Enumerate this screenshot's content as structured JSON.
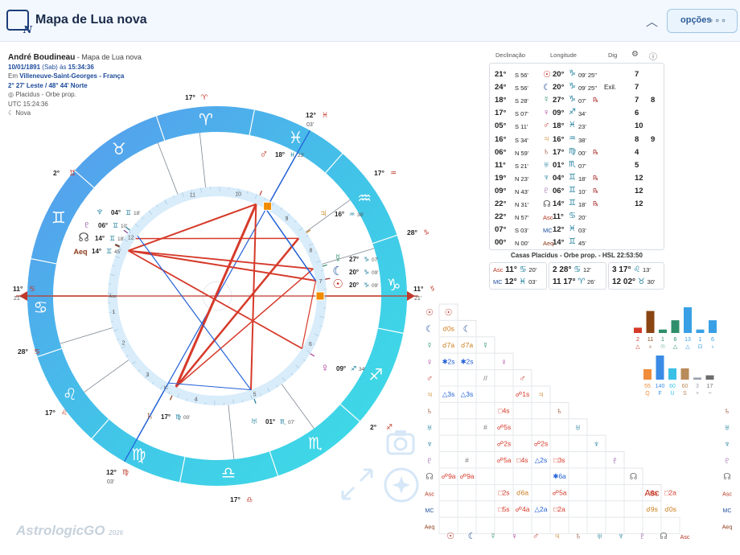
{
  "app": {
    "title": "Mapa de Lua nova",
    "options_label": "opções",
    "options_dots": "∘∘∘",
    "icon_letter": "N"
  },
  "info": {
    "name": "André Boudineau",
    "chart_kind": " - Mapa de Lua nova",
    "date": "10/01/1891",
    "weekday": "(Sab) às",
    "time": "15:34:36",
    "place_prefix": "Em",
    "place": "Villeneuve-Saint-Georges - França",
    "coords": "2° 27' Leste / 48° 44' Norte",
    "system": "Placidus - Orbe prop.",
    "utc": "UTC 15:24:36",
    "phase": "Nova"
  },
  "table": {
    "headers": {
      "decl": "Declinação",
      "long": "Longitude",
      "dig": "Dig"
    },
    "rows": [
      {
        "d": "21°",
        "dm": "S 56'",
        "g": "☉",
        "gc": "#c0392b",
        "lv": "20°",
        "s": "♑",
        "lm": "09' 25''",
        "rt": "",
        "dg": "",
        "n1": "7",
        "n2": ""
      },
      {
        "d": "24°",
        "dm": "S 56'",
        "g": "☾",
        "gc": "#1d4fa0",
        "lv": "20°",
        "s": "♑",
        "lm": "09' 25''",
        "rt": "",
        "dg": "Exil.",
        "n1": "7",
        "n2": ""
      },
      {
        "d": "18°",
        "dm": "S 28'",
        "g": "☿",
        "gc": "#2f8f6a",
        "lv": "27°",
        "s": "♑",
        "lm": "07'",
        "rt": "℞",
        "dg": "",
        "n1": "7",
        "n2": "8"
      },
      {
        "d": "17°",
        "dm": "S 07'",
        "g": "♀",
        "gc": "#a7359a",
        "lv": "09°",
        "s": "♐",
        "lm": "34'",
        "rt": "",
        "dg": "",
        "n1": "6",
        "n2": ""
      },
      {
        "d": "05°",
        "dm": "S 11'",
        "g": "♂",
        "gc": "#c0392b",
        "lv": "18°",
        "s": "♓",
        "lm": "23'",
        "rt": "",
        "dg": "",
        "n1": "10",
        "n2": ""
      },
      {
        "d": "16°",
        "dm": "S 34'",
        "g": "♃",
        "gc": "#c97a16",
        "lv": "16°",
        "s": "♒",
        "lm": "38'",
        "rt": "",
        "dg": "",
        "n1": "8",
        "n2": "9"
      },
      {
        "d": "06°",
        "dm": "N 59'",
        "g": "♄",
        "gc": "#8b3a1a",
        "lv": "17°",
        "s": "♍",
        "lm": "00'",
        "rt": "℞",
        "dg": "",
        "n1": "4",
        "n2": ""
      },
      {
        "d": "11°",
        "dm": "S 21'",
        "g": "♅",
        "gc": "#1b7d9a",
        "lv": "01°",
        "s": "♏",
        "lm": "07'",
        "rt": "",
        "dg": "",
        "n1": "5",
        "n2": ""
      },
      {
        "d": "19°",
        "dm": "N 23'",
        "g": "♆",
        "gc": "#1b7d9a",
        "lv": "04°",
        "s": "♊",
        "lm": "18'",
        "rt": "℞",
        "dg": "",
        "n1": "12",
        "n2": ""
      },
      {
        "d": "09°",
        "dm": "N 43'",
        "g": "♇",
        "gc": "#7b3590",
        "lv": "06°",
        "s": "♊",
        "lm": "10'",
        "rt": "℞",
        "dg": "",
        "n1": "12",
        "n2": ""
      },
      {
        "d": "22°",
        "dm": "N 31'",
        "g": "☊",
        "gc": "#555",
        "lv": "14°",
        "s": "♊",
        "lm": "18'",
        "rt": "℞",
        "dg": "",
        "n1": "12",
        "n2": ""
      },
      {
        "d": "22°",
        "dm": "N 57'",
        "g": "Asc",
        "gc": "#b8331f",
        "lv": "11°",
        "s": "♋",
        "lm": "20'",
        "rt": "",
        "dg": "",
        "n1": "",
        "n2": ""
      },
      {
        "d": "07°",
        "dm": "S 03'",
        "g": "MC",
        "gc": "#1d4fa0",
        "lv": "12°",
        "s": "♓",
        "lm": "03'",
        "rt": "",
        "dg": "",
        "n1": "",
        "n2": ""
      },
      {
        "d": "00°",
        "dm": "N 00'",
        "g": "Aeq",
        "gc": "#8b3a1a",
        "lv": "14°",
        "s": "♊",
        "lm": "45'",
        "rt": "",
        "dg": "",
        "n1": "",
        "n2": ""
      }
    ]
  },
  "houses": {
    "title": "Casas Placidus - Orbe prop. - HSL 22:53:50",
    "a": [
      {
        "h": "Asc",
        "v": "11°",
        "s": "♋",
        "m": "20'"
      },
      {
        "h": "MC",
        "v": "12°",
        "s": "♓",
        "m": "03'"
      }
    ],
    "b": [
      {
        "h": "2",
        "v": "28°",
        "s": "♋",
        "m": "12'"
      },
      {
        "h": "11",
        "v": "17°",
        "s": "♈",
        "m": "26'"
      }
    ],
    "c": [
      {
        "h": "3",
        "v": "17°",
        "s": "♌",
        "m": "13'"
      },
      {
        "h": "12",
        "v": "02°",
        "s": "♉",
        "m": "30'"
      }
    ]
  },
  "wheel": {
    "cusp_labels": [
      {
        "t": "11°",
        "s": "♋",
        "m": "21'",
        "side": "left"
      },
      {
        "t": "11°",
        "s": "♑",
        "m": "21'",
        "side": "right"
      },
      {
        "t": "12°",
        "s": "♓",
        "m": "03'"
      },
      {
        "t": "12°",
        "s": "♍",
        "m": "03'"
      },
      {
        "t": "17°",
        "s": "♈"
      },
      {
        "t": "17°",
        "s": "♎"
      },
      {
        "t": "17°",
        "s": "♒"
      },
      {
        "t": "17°",
        "s": "♌"
      },
      {
        "t": "28°",
        "s": "♑"
      },
      {
        "t": "28°",
        "s": "♋"
      },
      {
        "t": "2°",
        "s": "♊"
      },
      {
        "t": "2°",
        "s": "♐"
      }
    ],
    "planet_labels": [
      {
        "g": "♂",
        "t": "18°",
        "s": "♓",
        "m": "23'"
      },
      {
        "g": "♃",
        "t": "16°",
        "s": "♒",
        "m": "38'"
      },
      {
        "g": "☿",
        "t": "27°",
        "s": "♑",
        "m": "07'"
      },
      {
        "g": "☾",
        "t": "20°",
        "s": "♑",
        "m": "09'"
      },
      {
        "g": "☉",
        "t": "20°",
        "s": "♑",
        "m": "09'"
      },
      {
        "g": "♀",
        "t": "09°",
        "s": "♐",
        "m": "34'"
      },
      {
        "g": "♅",
        "t": "01°",
        "s": "♏",
        "m": "07'"
      },
      {
        "g": "♄",
        "t": "17°",
        "s": "♍",
        "m": "00'"
      },
      {
        "g": "♆",
        "t": "04°",
        "s": "♊",
        "m": "18'"
      },
      {
        "g": "♇",
        "t": "06°",
        "s": "♊",
        "m": "10'"
      },
      {
        "g": "☊",
        "t": "14°",
        "s": "♊",
        "m": "18'"
      },
      {
        "g": "Aeq",
        "t": "14°",
        "s": "♊",
        "m": "45'"
      }
    ],
    "zodiac_symbols": [
      "♈",
      "♉",
      "♊",
      "♋",
      "♌",
      "♍",
      "♎",
      "♏",
      "♐",
      "♑",
      "♒",
      "♓"
    ],
    "house_numbers": [
      "1",
      "2",
      "3",
      "4",
      "5",
      "6",
      "7",
      "8",
      "9",
      "10",
      "11",
      "12"
    ],
    "axis_labels": [
      "Asc",
      "Dsc",
      "MC",
      "IC"
    ]
  },
  "stats": {
    "top": [
      {
        "v": "2",
        "k": "△"
      },
      {
        "v": "11",
        "k": "♁"
      },
      {
        "v": "1",
        "k": "☉"
      },
      {
        "v": "6",
        "k": "△"
      },
      {
        "v": "13",
        "k": "△"
      },
      {
        "v": "1",
        "k": "⊡"
      },
      {
        "v": "6",
        "k": "♁"
      }
    ],
    "bottom": [
      {
        "v": "55",
        "k": "Q"
      },
      {
        "v": "140",
        "k": "F"
      },
      {
        "v": "60",
        "k": "Ú"
      },
      {
        "v": "60",
        "k": "S"
      },
      {
        "v": "3",
        "k": "+"
      },
      {
        "v": "17",
        "k": "−"
      }
    ]
  },
  "aspect_grid": {
    "rows": [
      "☉",
      "☾",
      "☿",
      "♀",
      "♂",
      "♃",
      "♄",
      "♅",
      "♆",
      "♇",
      "☊",
      "Asc",
      "MC",
      "Aeq"
    ],
    "cells": [
      [
        "☌0s"
      ],
      [
        "☌7a",
        "☌7a"
      ],
      [
        "✱2s",
        "✱2s",
        "",
        ""
      ],
      [
        "",
        "",
        "//"
      ],
      [
        "△3s",
        "△3s",
        "",
        "",
        "☍1s"
      ],
      [
        "",
        "",
        "",
        "□4s"
      ],
      [
        "",
        "",
        "#",
        "☍5s"
      ],
      [
        "",
        "",
        "",
        "☍2s",
        "",
        "☍2s"
      ],
      [
        "",
        "#",
        "",
        "☍5a",
        "□4s",
        "△2s",
        "□3s"
      ],
      [
        "☍9a",
        "☍9a",
        "",
        "",
        "",
        "",
        "✱6a"
      ],
      [
        "",
        "",
        "",
        "□2s",
        "☌6a",
        "",
        "☍5a",
        "",
        "",
        "",
        "",
        "□6s",
        "□2a"
      ],
      [
        "",
        "",
        "",
        "□5s",
        "☍4a",
        "△2a",
        "□2a",
        "",
        "",
        "",
        "",
        "☌9s",
        "☌0s"
      ]
    ],
    "footer": [
      "☉",
      "☾",
      "☿",
      "♀",
      "♂",
      "♃",
      "♄",
      "♅",
      "♆",
      "♇",
      "☊",
      "Asc"
    ]
  },
  "logo": {
    "text": "AstrologicGO",
    "year": "2026"
  },
  "colors": {
    "accent": "#2d5d9a",
    "red": "#d63a2a",
    "blue": "#2160d6"
  }
}
